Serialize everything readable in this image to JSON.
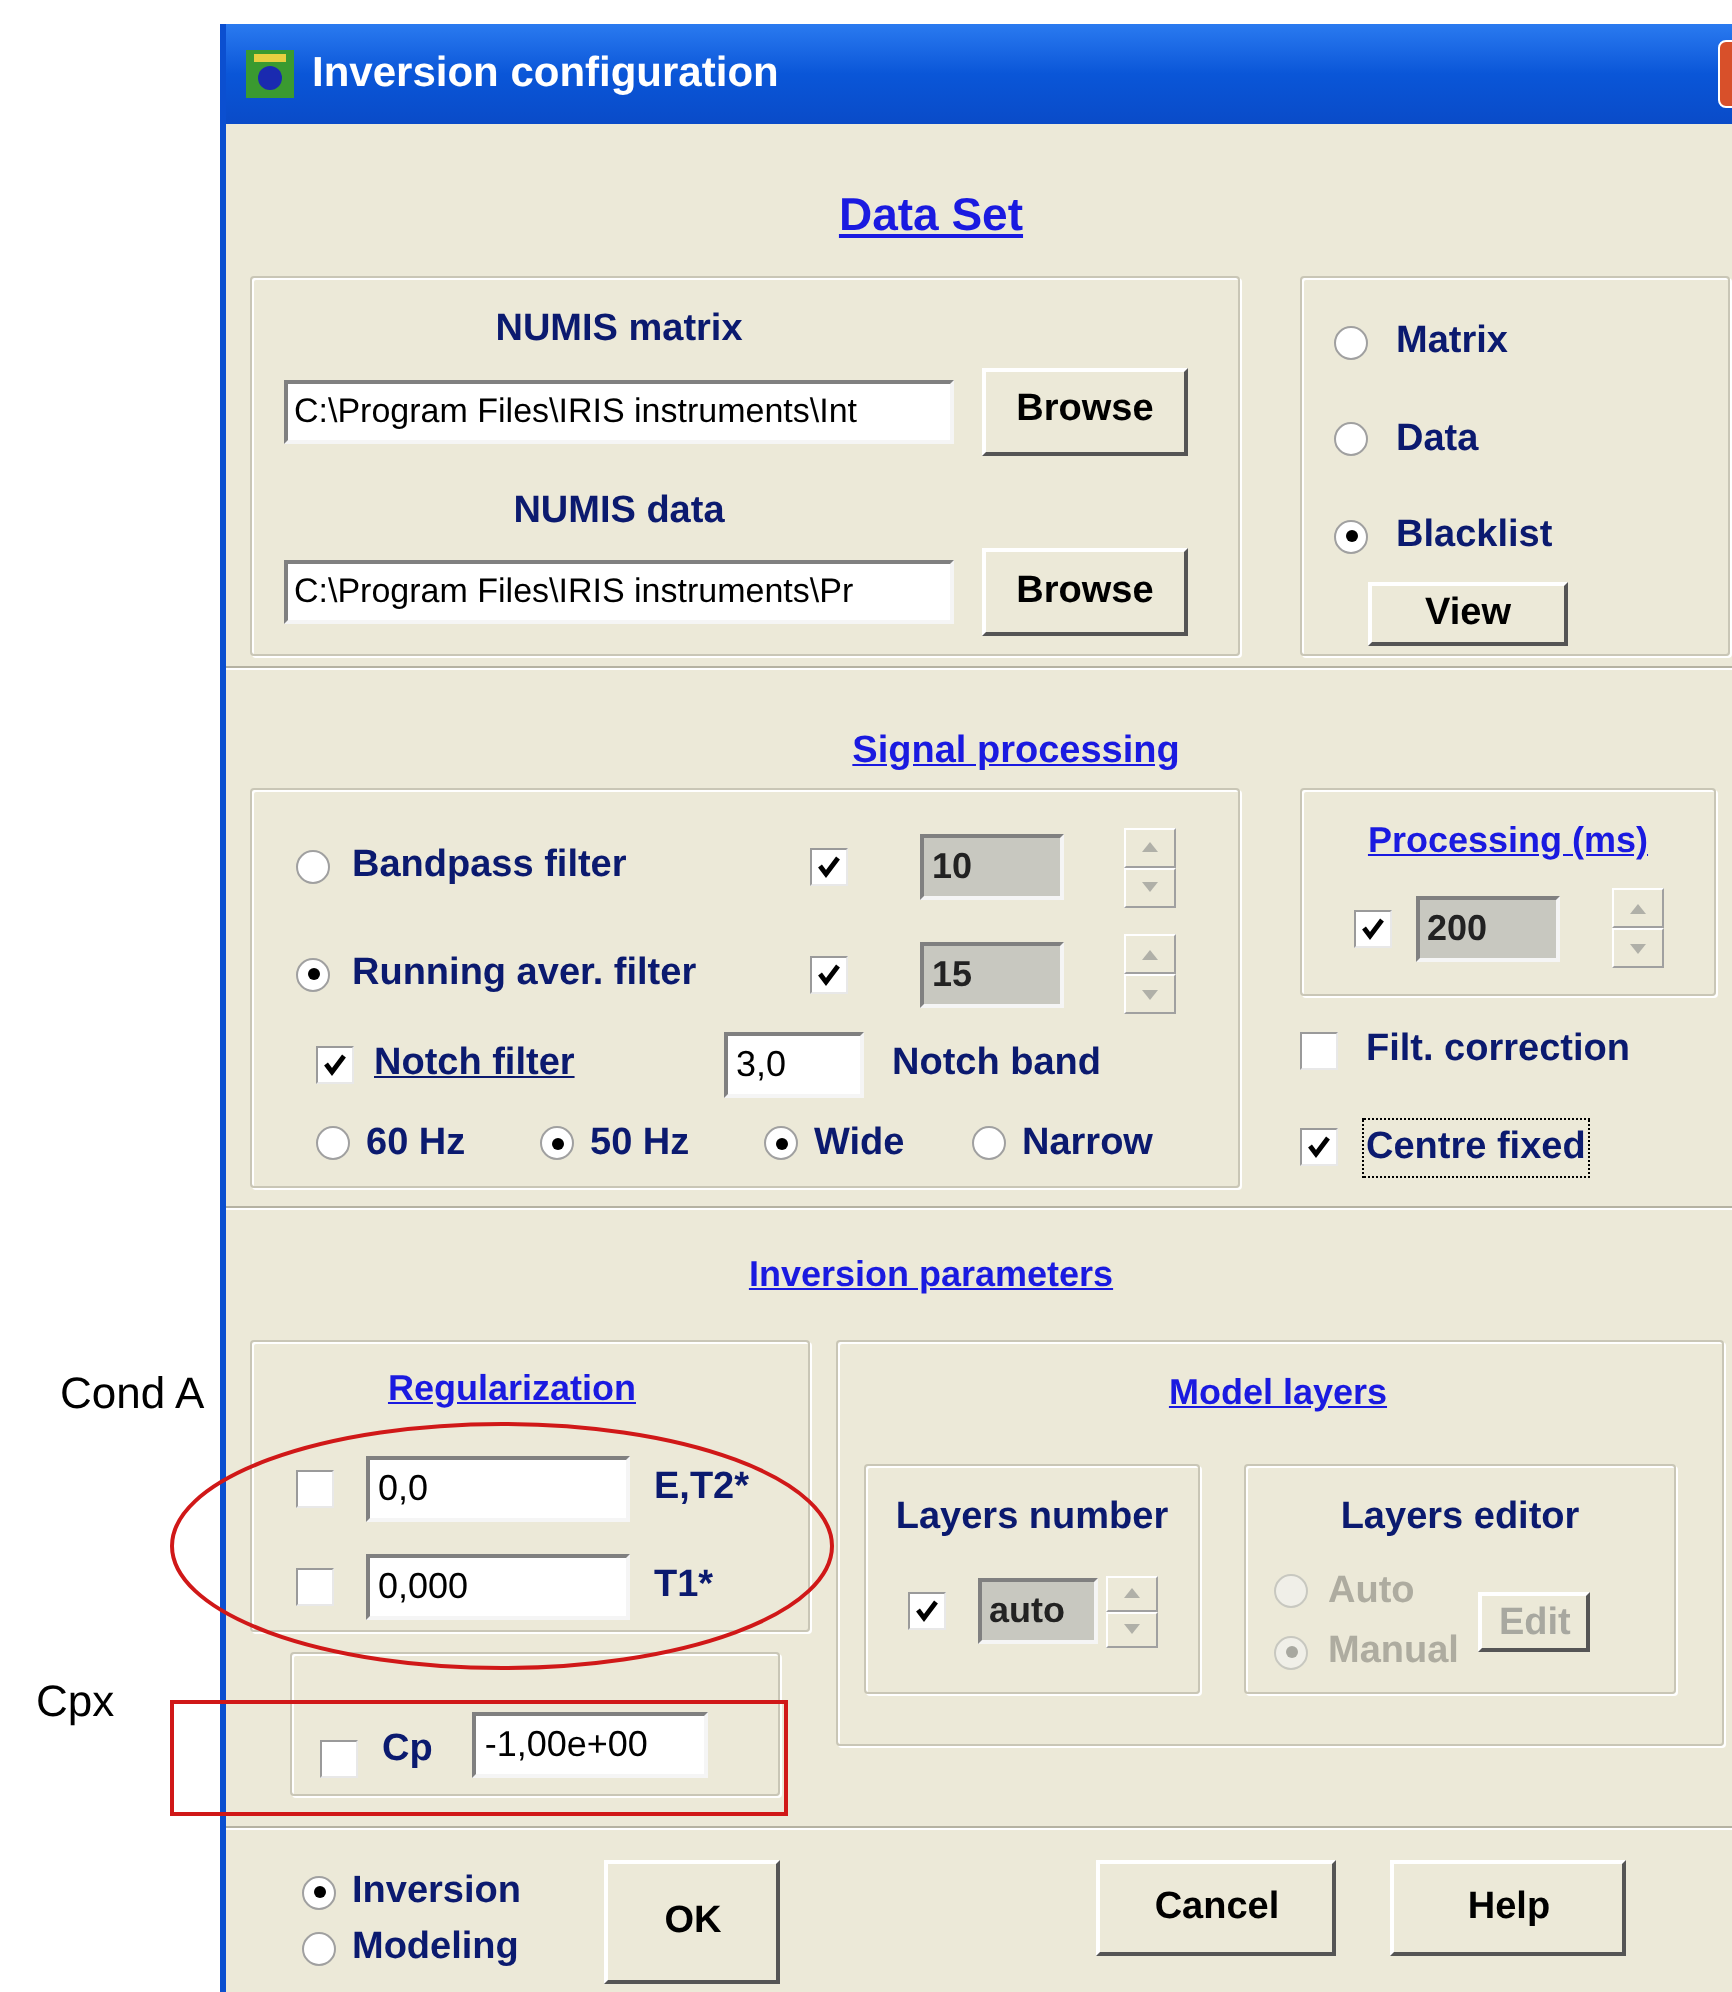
{
  "window": {
    "title": "Inversion configuration"
  },
  "data_set": {
    "heading": "Data Set",
    "files": [
      {
        "label": "NUMIS matrix",
        "value": "C:\\Program Files\\IRIS instruments\\Int",
        "button": "Browse"
      },
      {
        "label": "NUMIS data",
        "value": "C:\\Program Files\\IRIS instruments\\Pr",
        "button": "Browse"
      }
    ],
    "source_options": [
      {
        "label": "Matrix",
        "selected": false
      },
      {
        "label": "Data",
        "selected": false
      },
      {
        "label": "Blacklist",
        "selected": true
      }
    ],
    "view_button": "View"
  },
  "signal_processing": {
    "heading": "Signal processing",
    "filters": [
      {
        "label": "Bandpass filter",
        "selected": false,
        "checked": true,
        "value": "10"
      },
      {
        "label": "Running aver. filter",
        "selected": true,
        "checked": true,
        "value": "15"
      }
    ],
    "notch": {
      "label": "Notch filter",
      "checked": true,
      "value": "3,0",
      "band_label": "Notch band"
    },
    "frequency_options": [
      {
        "label": "60 Hz",
        "selected": false
      },
      {
        "label": "50 Hz",
        "selected": true
      }
    ],
    "band_options": [
      {
        "label": "Wide",
        "selected": true
      },
      {
        "label": "Narrow",
        "selected": false
      }
    ],
    "processing": {
      "heading": "Processing (ms)",
      "checked": true,
      "value": "200"
    },
    "options": [
      {
        "label": "Filt. correction",
        "checked": false,
        "focused": false
      },
      {
        "label": "Centre fixed",
        "checked": true,
        "focused": true
      }
    ]
  },
  "inversion_parameters": {
    "heading": "Inversion parameters",
    "regularization": {
      "heading": "Regularization",
      "rows": [
        {
          "checked": false,
          "value": "0,0",
          "label": "E,T2*"
        },
        {
          "checked": false,
          "value": "0,000",
          "label": "T1*"
        }
      ]
    },
    "cp": {
      "label": "Cp",
      "checked": false,
      "value": "-1,00e+00"
    },
    "model_layers": {
      "heading": "Model layers",
      "layers_number": {
        "label": "Layers number",
        "checked": true,
        "value": "auto"
      },
      "layers_editor": {
        "label": "Layers editor",
        "disabled": true,
        "options": [
          {
            "label": "Auto",
            "selected": false
          },
          {
            "label": "Manual",
            "selected": true
          }
        ],
        "edit_button": "Edit"
      }
    }
  },
  "mode_options": [
    {
      "label": "Inversion",
      "selected": true
    },
    {
      "label": "Modeling",
      "selected": false
    }
  ],
  "buttons": [
    "OK",
    "Cancel",
    "Help"
  ],
  "annotations": [
    {
      "kind": "label",
      "text": "Cond A"
    },
    {
      "kind": "ellipse"
    },
    {
      "kind": "label",
      "text": "Cpx"
    },
    {
      "kind": "rectangle"
    }
  ]
}
